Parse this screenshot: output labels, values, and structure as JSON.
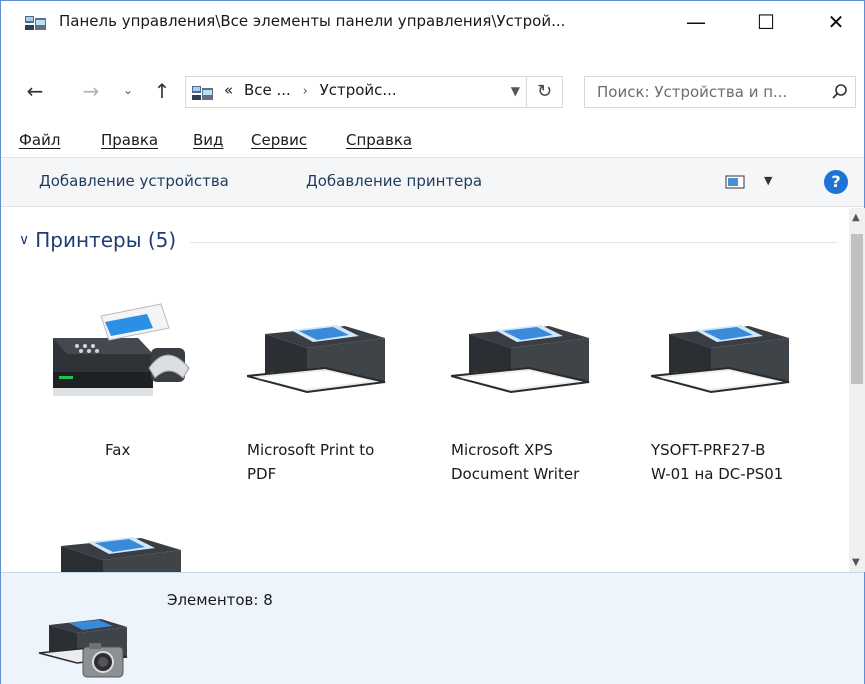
{
  "window": {
    "title": "Панель управления\\Все элементы панели управления\\Устрой...",
    "minimize_glyph": "—",
    "maximize_glyph": "☐",
    "close_glyph": "✕"
  },
  "nav": {
    "back_glyph": "←",
    "forward_glyph": "→",
    "recent_glyph": "⌄",
    "up_glyph": "↑",
    "breadcrumb": [
      "«",
      "Все ...",
      "Устройс..."
    ],
    "breadcrumb_sep": "›",
    "refresh_glyph": "↻",
    "search_placeholder": "Поиск: Устройства и п..."
  },
  "menu": {
    "items": [
      "Файл",
      "Правка",
      "Вид",
      "Сервис",
      "Справка"
    ]
  },
  "commands": {
    "add_device": "Добавление устройства",
    "add_printer": "Добавление принтера",
    "help": "?"
  },
  "group": {
    "title": "Принтеры (5)",
    "chevron": "∨"
  },
  "devices": [
    {
      "label_line1": "Fax",
      "label_line2": "",
      "icon": "fax-icon"
    },
    {
      "label_line1": "Microsoft Print to",
      "label_line2": "PDF",
      "icon": "printer-icon"
    },
    {
      "label_line1": "Microsoft XPS",
      "label_line2": "Document Writer",
      "icon": "printer-icon"
    },
    {
      "label_line1": "YSOFT-PRF27-B",
      "label_line2": "W-01 на DC-PS01",
      "icon": "printer-icon"
    },
    {
      "label_line1": "",
      "label_line2": "",
      "icon": "printer-icon"
    }
  ],
  "details": {
    "count": "Элементов: 8"
  },
  "colors": {
    "accent": "#1e73d6",
    "group_title": "#1f3d73",
    "details_bg": "#eef4fb"
  }
}
